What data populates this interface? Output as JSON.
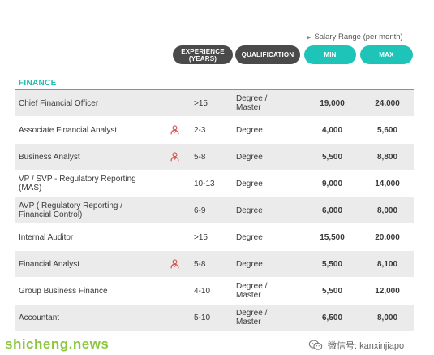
{
  "header": {
    "salary_range_label": "Salary Range (per month)",
    "experience_label_1": "EXPERIENCE",
    "experience_label_2": "(YEARS)",
    "qualification_label": "QUALIFICATION",
    "min_label": "MIN",
    "max_label": "MAX"
  },
  "section": {
    "title": "FINANCE"
  },
  "colors": {
    "accent": "#1fc4b8",
    "dark_pill": "#4a4a4a",
    "icon_red": "#d9534f",
    "watermark_green": "#8cc63f"
  },
  "rows": [
    {
      "title_1": "Chief Financial Officer",
      "title_2": "",
      "icon": "",
      "exp": ">15",
      "qual_1": "Degree /",
      "qual_2": "Master",
      "min": "19,000",
      "max": "24,000"
    },
    {
      "title_1": "Associate Financial Analyst",
      "title_2": "",
      "icon": "person-icon",
      "exp": "2-3",
      "qual_1": "Degree",
      "qual_2": "",
      "min": "4,000",
      "max": "5,600"
    },
    {
      "title_1": "Business Analyst",
      "title_2": "",
      "icon": "person-icon",
      "exp": "5-8",
      "qual_1": "Degree",
      "qual_2": "",
      "min": "5,500",
      "max": "8,800"
    },
    {
      "title_1": "VP / SVP - Regulatory Reporting",
      "title_2": "(MAS)",
      "icon": "",
      "exp": "10-13",
      "qual_1": "Degree",
      "qual_2": "",
      "min": "9,000",
      "max": "14,000"
    },
    {
      "title_1": "AVP ( Regulatory Reporting /",
      "title_2": "Financial Control)",
      "icon": "",
      "exp": "6-9",
      "qual_1": "Degree",
      "qual_2": "",
      "min": "6,000",
      "max": "8,000"
    },
    {
      "title_1": "Internal Auditor",
      "title_2": "",
      "icon": "",
      "exp": ">15",
      "qual_1": "Degree",
      "qual_2": "",
      "min": "15,500",
      "max": "20,000"
    },
    {
      "title_1": "Financial Analyst",
      "title_2": "",
      "icon": "person-icon",
      "exp": "5-8",
      "qual_1": "Degree",
      "qual_2": "",
      "min": "5,500",
      "max": "8,100"
    },
    {
      "title_1": "Group Business Finance",
      "title_2": "",
      "icon": "",
      "exp": "4-10",
      "qual_1": "Degree /",
      "qual_2": "Master",
      "min": "5,500",
      "max": "12,000"
    },
    {
      "title_1": "Accountant",
      "title_2": "",
      "icon": "",
      "exp": "5-10",
      "qual_1": "Degree /",
      "qual_2": "Master",
      "min": "6,500",
      "max": "8,000"
    }
  ],
  "watermarks": {
    "left": "shicheng.news",
    "right": "微信号: kanxinjiapo"
  }
}
